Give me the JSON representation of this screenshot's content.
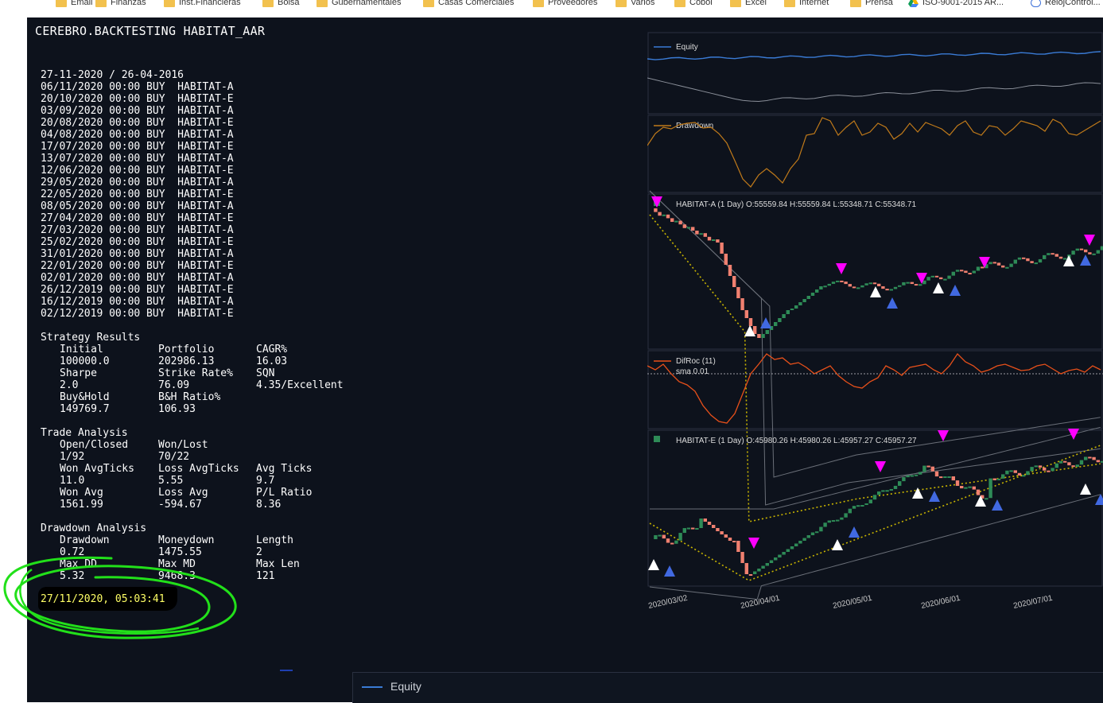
{
  "bookmarks": [
    {
      "label": "Email",
      "icon": "folder-icon"
    },
    {
      "label": "Finanzas",
      "icon": "folder-icon"
    },
    {
      "label": "Inst.Financieras",
      "icon": "folder-icon"
    },
    {
      "label": "Bolsa",
      "icon": "folder-icon"
    },
    {
      "label": "Gubernamentales",
      "icon": "folder-icon"
    },
    {
      "label": "Casas Comerciales",
      "icon": "folder-icon"
    },
    {
      "label": "Proveedores",
      "icon": "folder-icon"
    },
    {
      "label": "Varios",
      "icon": "folder-icon"
    },
    {
      "label": "Cobol",
      "icon": "folder-icon"
    },
    {
      "label": "Excel",
      "icon": "folder-icon"
    },
    {
      "label": "Internet",
      "icon": "folder-icon"
    },
    {
      "label": "Prensa",
      "icon": "folder-icon"
    },
    {
      "label": "ISO-9001-2015 AR...",
      "icon": "google-drive-icon"
    },
    {
      "label": "RelojControl...",
      "icon": "clock-link-icon"
    }
  ],
  "report": {
    "title": "CEREBRO.BACKTESTING HABITAT_AAR",
    "date_range": "27-11-2020 / 26-04-2016",
    "trades": [
      "06/11/2020 00:00 BUY  HABITAT-A",
      "20/10/2020 00:00 BUY  HABITAT-E",
      "03/09/2020 00:00 BUY  HABITAT-A",
      "20/08/2020 00:00 BUY  HABITAT-E",
      "04/08/2020 00:00 BUY  HABITAT-A",
      "17/07/2020 00:00 BUY  HABITAT-E",
      "13/07/2020 00:00 BUY  HABITAT-A",
      "12/06/2020 00:00 BUY  HABITAT-E",
      "29/05/2020 00:00 BUY  HABITAT-A",
      "22/05/2020 00:00 BUY  HABITAT-E",
      "08/05/2020 00:00 BUY  HABITAT-A",
      "27/04/2020 00:00 BUY  HABITAT-E",
      "27/03/2020 00:00 BUY  HABITAT-A",
      "25/02/2020 00:00 BUY  HABITAT-E",
      "31/01/2020 00:00 BUY  HABITAT-A",
      "22/01/2020 00:00 BUY  HABITAT-E",
      "02/01/2020 00:00 BUY  HABITAT-A",
      "26/12/2019 00:00 BUY  HABITAT-E",
      "16/12/2019 00:00 BUY  HABITAT-A",
      "02/12/2019 00:00 BUY  HABITAT-E"
    ],
    "strategy": {
      "heading": "Strategy Results",
      "rows": [
        [
          "Initial",
          "Portfolio",
          "CAGR%"
        ],
        [
          "100000.0",
          "202986.13",
          "16.03"
        ],
        [
          "Sharpe",
          "Strike Rate%",
          "SQN"
        ],
        [
          "2.0",
          "76.09",
          "4.35/Excellent"
        ],
        [
          "Buy&Hold",
          "B&H Ratio%",
          ""
        ],
        [
          "149769.7",
          "106.93",
          ""
        ]
      ]
    },
    "trade_analysis": {
      "heading": "Trade Analysis",
      "rows": [
        [
          "Open/Closed",
          "Won/Lost",
          ""
        ],
        [
          "1/92",
          "70/22",
          ""
        ],
        [
          "Won AvgTicks",
          "Loss AvgTicks",
          "Avg Ticks"
        ],
        [
          "11.0",
          "5.55",
          "9.7"
        ],
        [
          "Won Avg",
          "Loss Avg",
          "P/L Ratio"
        ],
        [
          "1561.99",
          "-594.67",
          "8.36"
        ]
      ]
    },
    "drawdown": {
      "heading": "Drawdown Analysis",
      "rows": [
        [
          "Drawdown",
          "Moneydown",
          "Length"
        ],
        [
          "0.72",
          "1475.55",
          "2"
        ],
        [
          "Max DD",
          "Max MD",
          "Max Len"
        ],
        [
          "5.32",
          "9468.3",
          "121"
        ]
      ]
    },
    "timestamp": "27/11/2020, 05:03:41"
  },
  "chart": {
    "panels": {
      "equity": "Equity",
      "drawdown": "Drawdown",
      "habitat_a": "HABITAT-A (1 Day) O:55559.84 H:55559.84 L:55348.71 C:55348.71",
      "difroc": "DifRoc (11)",
      "sma": "sma 0.01",
      "habitat_e": "HABITAT-E (1 Day) O:45980.26 H:45980.26 L:45957.27 C:45957.27"
    },
    "x_ticks": [
      "2020/03/02",
      "2020/04/01",
      "2020/05/01",
      "2020/06/01",
      "2020/07/01"
    ],
    "colors": {
      "background": "#0d121c",
      "equity": "#3a7bd5",
      "drawdown": "#c07a1a",
      "difroc": "#e8501a",
      "up_candle": "#2e8b57",
      "down_candle": "#f08070",
      "sell_marker": "#ff00ff",
      "buy_marker": "#4169e1"
    }
  },
  "bottom_panel": {
    "legend": "Equity"
  }
}
